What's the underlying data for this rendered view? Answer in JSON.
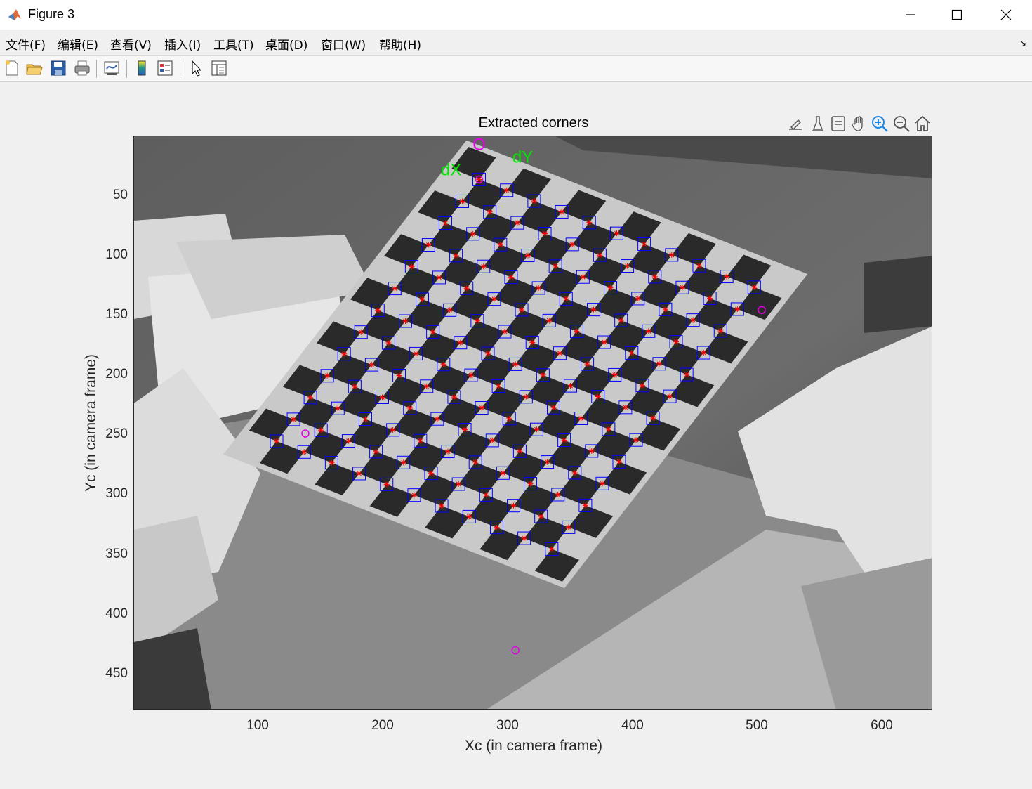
{
  "window": {
    "title": "Figure 3",
    "buttons": {
      "minimize": "minimize-icon",
      "maximize": "maximize-icon",
      "close": "close-icon"
    }
  },
  "menu": [
    "文件(F)",
    "编辑(E)",
    "查看(V)",
    "插入(I)",
    "工具(T)",
    "桌面(D)",
    "窗口(W)",
    "帮助(H)"
  ],
  "toolbar": [
    "new-figure-icon",
    "open-icon",
    "save-icon",
    "print-icon",
    "link-plot-icon",
    "colorbar-icon",
    "legend-icon",
    "edit-pointer-icon",
    "property-inspector-icon"
  ],
  "axes_toolbar": [
    "brush-icon",
    "data-cursor-icon",
    "restore-view-icon",
    "pan-icon",
    "zoom-in-icon",
    "zoom-out-icon",
    "home-icon"
  ],
  "plot": {
    "title": "Extracted corners",
    "xlabel": "Xc (in camera frame)",
    "ylabel": "Yc (in camera frame)",
    "xticks": [
      "100",
      "200",
      "300",
      "400",
      "500",
      "600"
    ],
    "yticks": [
      "50",
      "100",
      "150",
      "200",
      "250",
      "300",
      "350",
      "400",
      "450"
    ],
    "xlim": [
      1,
      640
    ],
    "ylim": [
      1,
      480
    ],
    "annotations": {
      "origin": "O",
      "dx": "dX",
      "dy": "dY"
    },
    "colors": {
      "origin": "#e600e6",
      "axes_text": "#00e600",
      "marker": "#ff0000",
      "box": "#0000ff"
    }
  },
  "chart_data": {
    "type": "scatter",
    "title": "Extracted corners",
    "xlabel": "Xc (in camera frame)",
    "ylabel": "Yc (in camera frame)",
    "xlim": [
      1,
      640
    ],
    "ylim": [
      1,
      480
    ],
    "grid_corners": {
      "origin": [
        277,
        37
      ],
      "x_step": [
        -13.5,
        18.2
      ],
      "y_step": [
        22.0,
        9.0
      ],
      "n_x": 13,
      "n_y": 11,
      "marked_corners": [
        [
          277,
          37
        ],
        [
          503,
          146
        ],
        [
          306,
          430
        ],
        [
          138,
          249
        ]
      ]
    }
  }
}
